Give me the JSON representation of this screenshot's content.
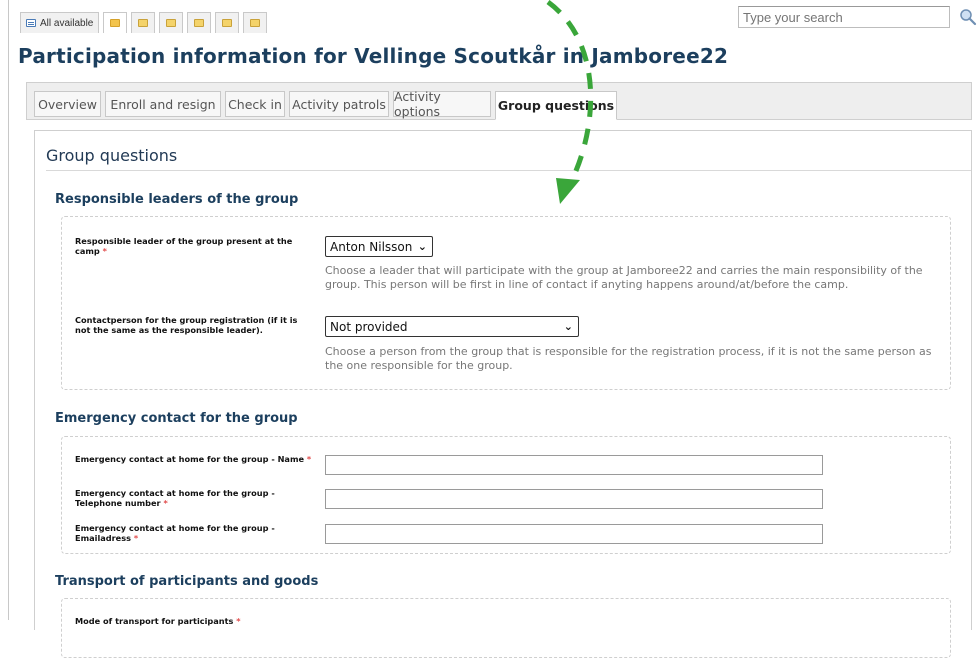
{
  "topbar": {
    "all_available_label": "All available",
    "search_placeholder": "Type your search"
  },
  "page": {
    "title": "Participation information for Vellinge Scoutkår in Jamboree22"
  },
  "tabs": [
    {
      "label": "Overview"
    },
    {
      "label": "Enroll and resign"
    },
    {
      "label": "Check in"
    },
    {
      "label": "Activity patrols"
    },
    {
      "label": "Activity options"
    },
    {
      "label": "Group questions",
      "active": true
    }
  ],
  "panel": {
    "title": "Group questions"
  },
  "sections": {
    "leaders": {
      "heading": "Responsible leaders of the group",
      "responsible_label": "Responsible leader of the group present at the camp",
      "responsible_value": "Anton Nilsson",
      "responsible_help": "Choose a leader that will participate with the group at Jamboree22 and carries the main responsibility of the group. This person will be first in line of contact if anyting happens around/at/before the camp.",
      "contact_label": "Contactperson for the group registration (if it is not the same as the responsible leader).",
      "contact_value": "Not provided",
      "contact_help": "Choose a person from the group that is responsible for the registration process, if it is not the same person as the one responsible for the group."
    },
    "emergency": {
      "heading": "Emergency contact for the group",
      "name_label": "Emergency contact at home for the group - Name",
      "phone_label": "Emergency contact at home for the group - Telephone number",
      "email_label": "Emergency contact at home for the group - Emailadress",
      "name_value": "",
      "phone_value": "",
      "email_value": ""
    },
    "transport": {
      "heading": "Transport of participants and goods",
      "mode_label": "Mode of transport for participants"
    }
  },
  "colors": {
    "title": "#1c3f5e",
    "required": "#e14a4a",
    "arrow": "#3aa63a"
  },
  "icons": [
    "list-icon",
    "folder-icon",
    "search-icon",
    "chevron-down-icon"
  ]
}
